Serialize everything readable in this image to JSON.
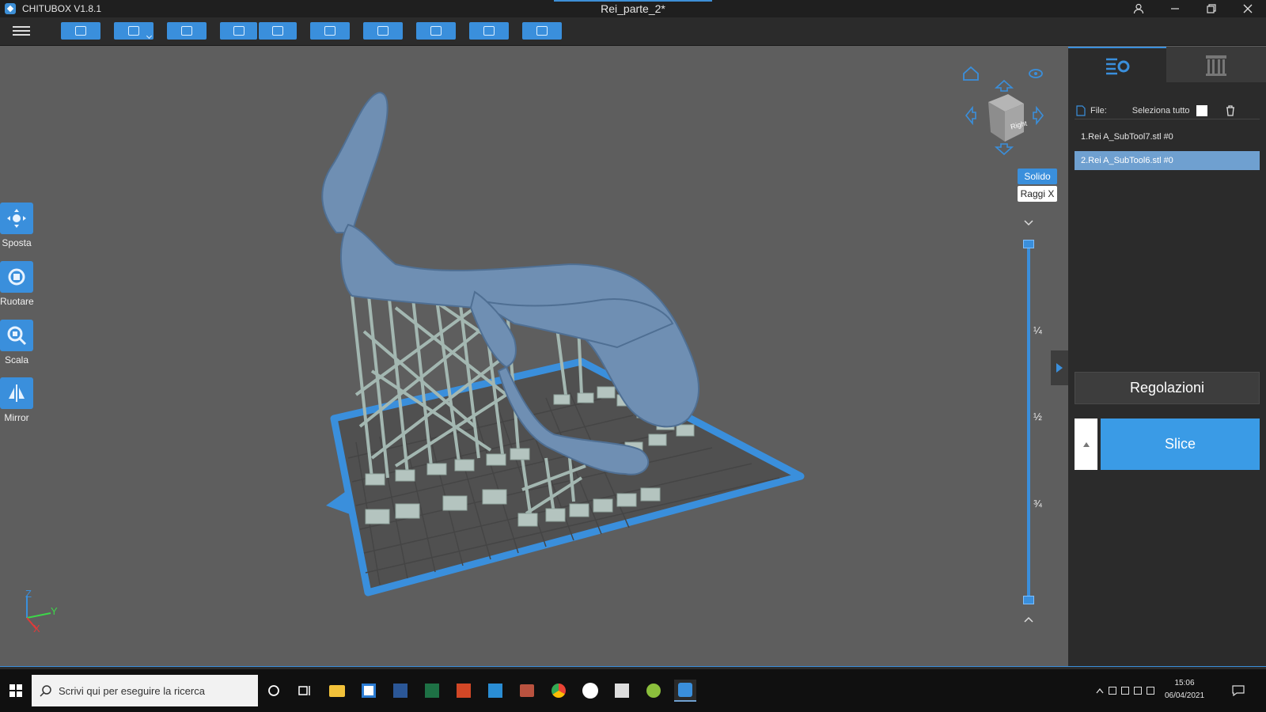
{
  "window": {
    "app_name": "CHITUBOX V1.8.1",
    "document_title": "Rei_parte_2*"
  },
  "toolbar": {
    "buttons": [
      {
        "name": "open-file",
        "icon": "folder-icon"
      },
      {
        "name": "save",
        "icon": "save-icon"
      },
      {
        "name": "screenshot",
        "icon": "screenshot-icon"
      },
      {
        "name": "undo",
        "icon": "undo-icon"
      },
      {
        "name": "redo",
        "icon": "redo-icon"
      },
      {
        "name": "auto-layout",
        "icon": "layout-icon"
      },
      {
        "name": "copy",
        "icon": "copy-icon"
      },
      {
        "name": "settings",
        "icon": "printer-settings-icon"
      },
      {
        "name": "hollow",
        "icon": "hollow-icon"
      },
      {
        "name": "dig-hole",
        "icon": "hole-icon"
      }
    ]
  },
  "left_tools": [
    {
      "label": "Sposta",
      "icon": "move-icon"
    },
    {
      "label": "Ruotare",
      "icon": "rotate-icon"
    },
    {
      "label": "Scala",
      "icon": "scale-icon"
    },
    {
      "label": "Mirror",
      "icon": "mirror-icon"
    }
  ],
  "view": {
    "cube_face": "Right",
    "solid_label": "Solido",
    "xray_label": "Raggi X",
    "axis_labels": {
      "z": "Z",
      "y": "Y",
      "x": "X"
    }
  },
  "layer_slider": {
    "marks": [
      "¼",
      "½",
      "¾"
    ]
  },
  "right_panel": {
    "file_label": "File:",
    "select_all_label": "Seleziona tutto",
    "files": [
      {
        "name": "1.Rei A_SubTool7.stl #0",
        "selected": false
      },
      {
        "name": "2.Rei A_SubTool6.stl #0",
        "selected": true
      }
    ],
    "adjust_label": "Regolazioni",
    "slice_label": "Slice"
  },
  "taskbar": {
    "search_placeholder": "Scrivi qui per eseguire la ricerca",
    "time": "15:06",
    "date": "06/04/2021"
  },
  "colors": {
    "accent": "#3a8fdc",
    "panel": "#2b2b2b",
    "viewport": "#5e5e5e",
    "model": "#6f8fb3",
    "supports": "#9fb3ad"
  }
}
